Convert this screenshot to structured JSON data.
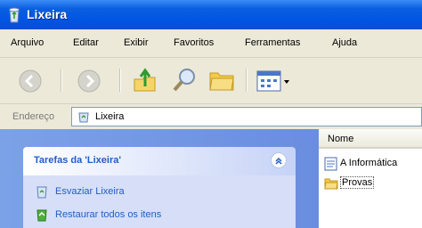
{
  "window": {
    "title": "Lixeira",
    "title_icon": "recycle-bin-icon"
  },
  "menu": {
    "items": [
      {
        "label": "Arquivo"
      },
      {
        "label": "Editar"
      },
      {
        "label": "Exibir"
      },
      {
        "label": "Favoritos"
      },
      {
        "label": "Ferramentas"
      },
      {
        "label": "Ajuda"
      }
    ]
  },
  "toolbar": {
    "buttons": [
      "back-icon",
      "forward-icon",
      "up-folder-icon",
      "search-icon",
      "folders-icon",
      "views-icon"
    ]
  },
  "address": {
    "label": "Endereço",
    "value": "Lixeira",
    "icon": "recycle-bin-icon"
  },
  "tasks": {
    "header": "Tarefas da 'Lixeira'",
    "items": [
      {
        "label": "Esvaziar Lixeira",
        "icon": "empty-bin-icon"
      },
      {
        "label": "Restaurar todos os itens",
        "icon": "restore-icon"
      }
    ]
  },
  "files": {
    "column_header": "Nome",
    "items": [
      {
        "label": "A Informática",
        "icon": "document-icon",
        "selected": false
      },
      {
        "label": "Provas",
        "icon": "folder-icon",
        "selected": true
      }
    ]
  },
  "colors": {
    "titlebar": "#0054e3",
    "task_link": "#215dc6",
    "left_pane": "#7ba2e7",
    "chrome": "#ece9d8"
  }
}
